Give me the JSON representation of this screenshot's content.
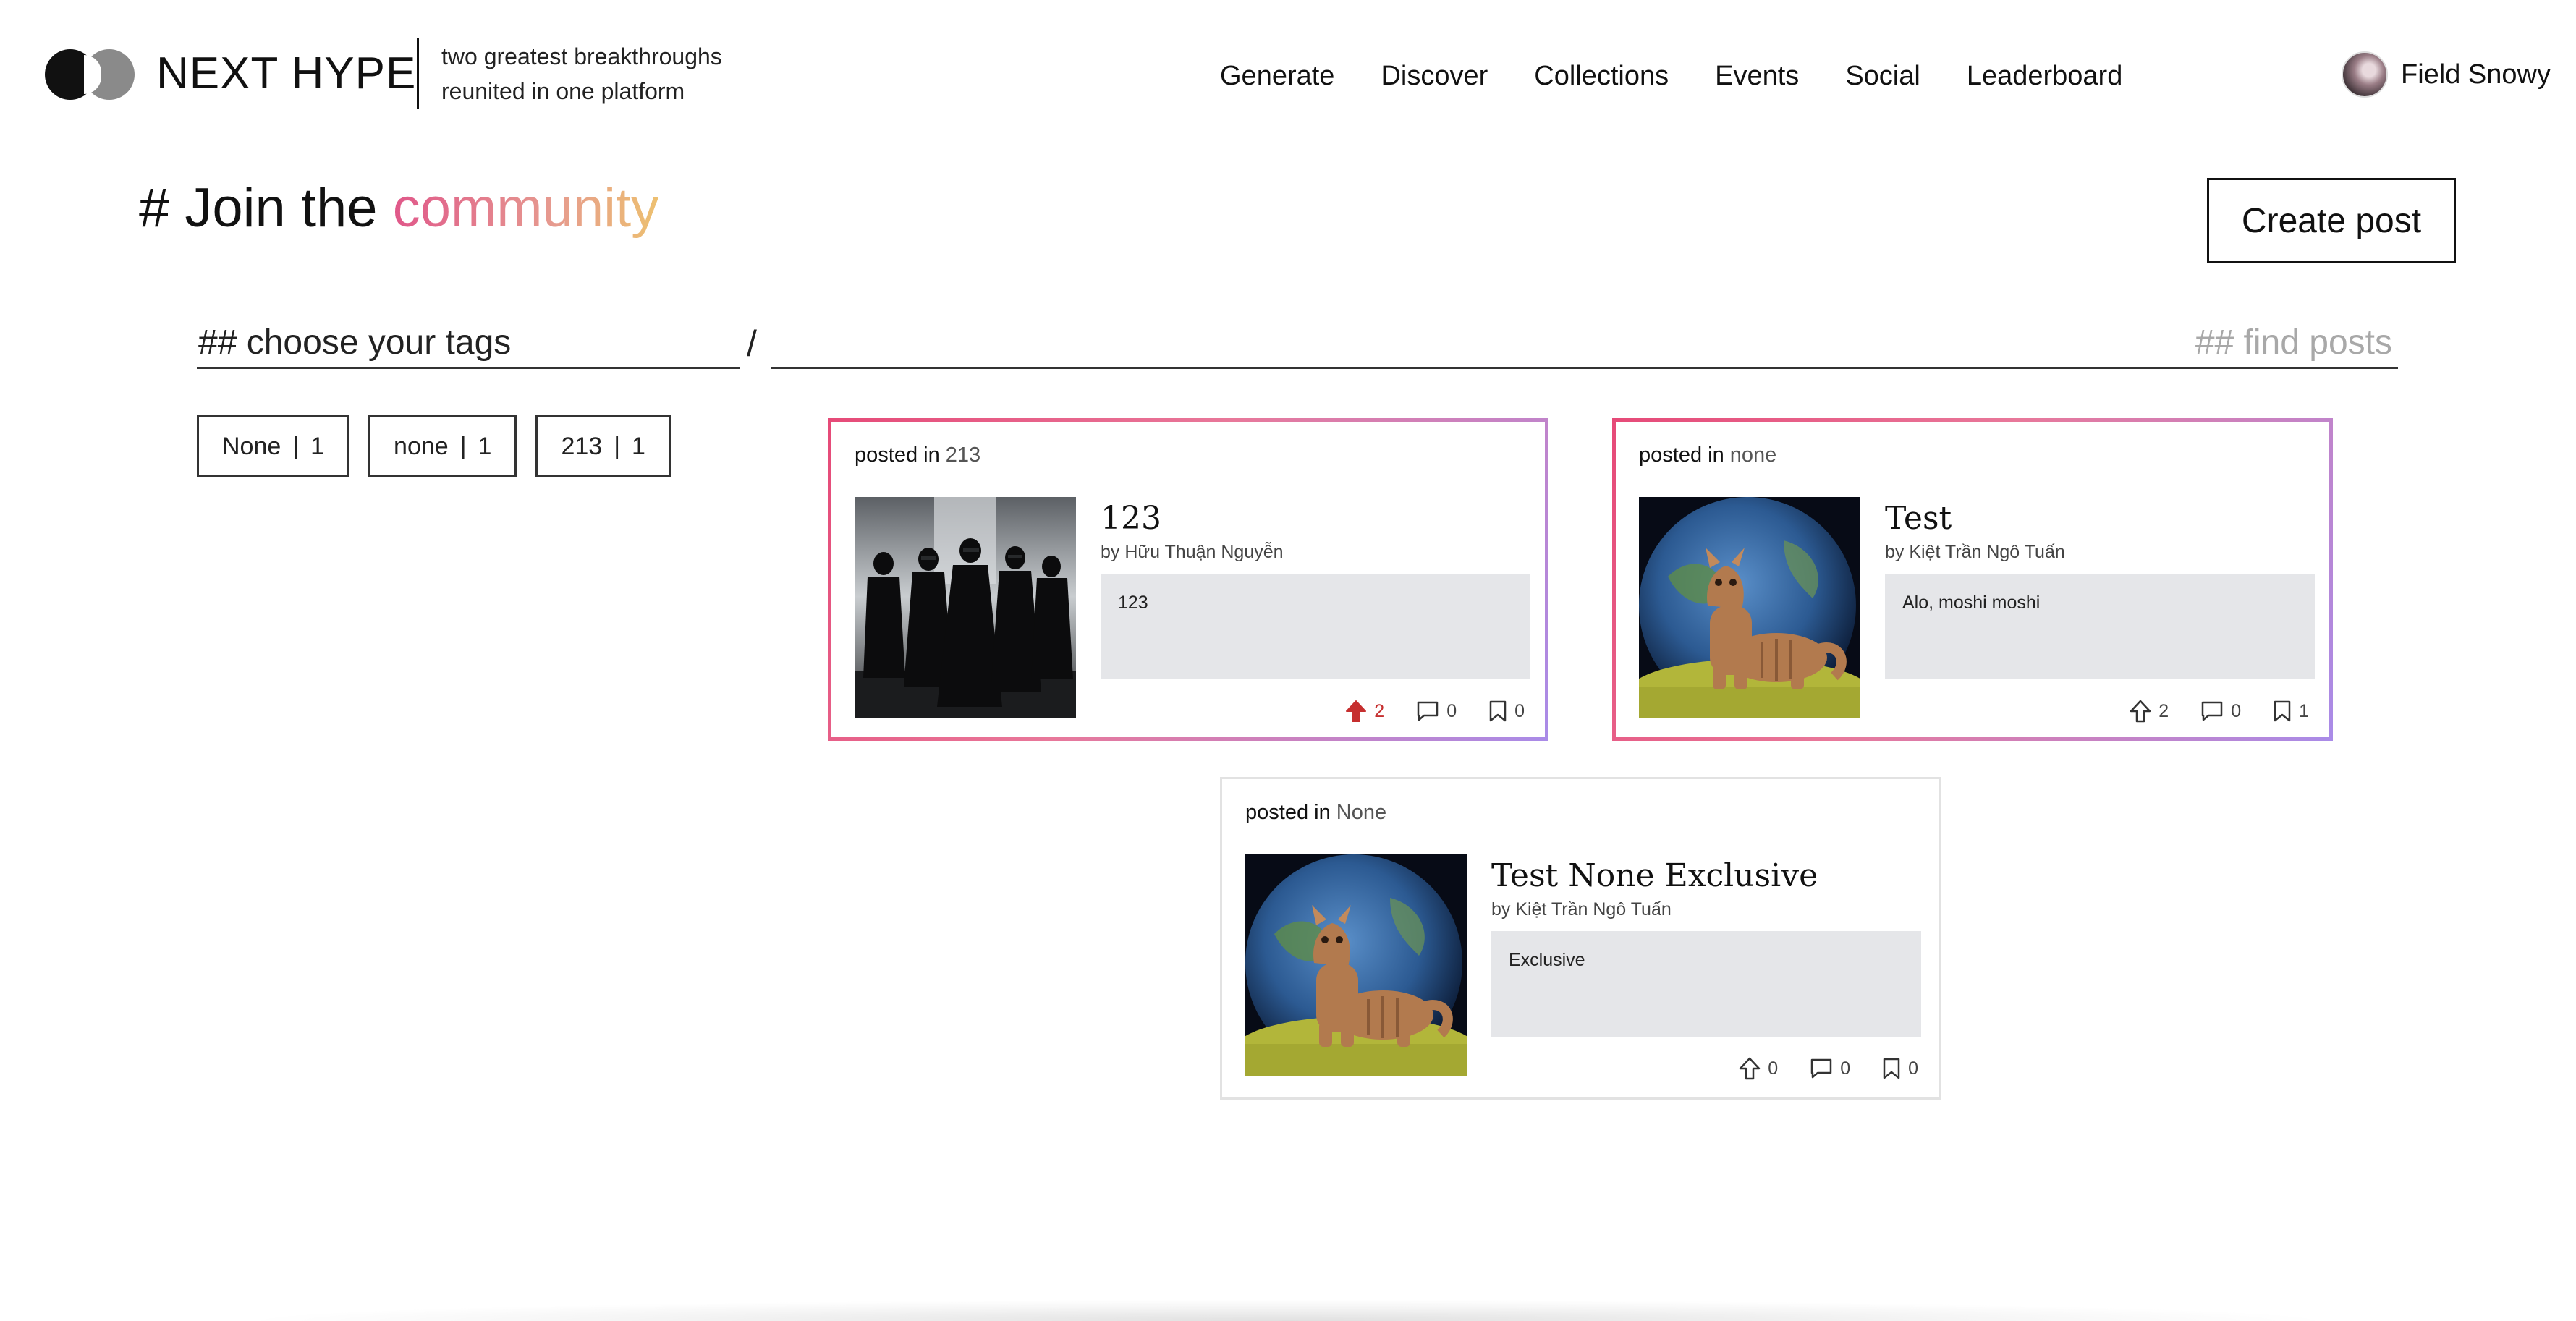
{
  "header": {
    "brand": "NEXT HYPE",
    "tagline_line1": "two greatest breakthroughs",
    "tagline_line2": "reunited in one platform",
    "nav": [
      "Generate",
      "Discover",
      "Collections",
      "Events",
      "Social",
      "Leaderboard"
    ],
    "user_name": "Field Snowy"
  },
  "title": {
    "prefix": "# Join the ",
    "highlight": "community"
  },
  "create_post_label": "Create post",
  "search": {
    "tags_placeholder": "## choose your tags",
    "separator": "/",
    "find_placeholder": "## find posts"
  },
  "tags": [
    {
      "name": "None",
      "count": "1"
    },
    {
      "name": "none",
      "count": "1"
    },
    {
      "name": "213",
      "count": "1"
    }
  ],
  "posts": [
    {
      "posted_label": "posted in",
      "tag": "213",
      "title": "123",
      "author": "by Hữu Thuận Nguyễn",
      "body": "123",
      "upvotes": "2",
      "comments": "0",
      "bookmarks": "0",
      "upvoted": true
    },
    {
      "posted_label": "posted in",
      "tag": "none",
      "title": "Test",
      "author": "by Kiệt Trần Ngô Tuấn",
      "body": "Alo, moshi moshi",
      "upvotes": "2",
      "comments": "0",
      "bookmarks": "1",
      "upvoted": false
    },
    {
      "posted_label": "posted in",
      "tag": "None",
      "title": "Test None Exclusive",
      "author": "by Kiệt Trần Ngô Tuấn",
      "body": "Exclusive",
      "upvotes": "0",
      "comments": "0",
      "bookmarks": "0",
      "upvoted": false
    }
  ],
  "colors": {
    "title_gradient": [
      "#e0588a",
      "#e69a8f",
      "#edc070"
    ],
    "card_border_gradient": [
      "#e64a78",
      "#e8789a",
      "#a98be8"
    ],
    "upvote_active": "#c62f2f"
  },
  "icons": [
    "logo-icon",
    "upvote-icon",
    "comment-icon",
    "bookmark-icon"
  ]
}
